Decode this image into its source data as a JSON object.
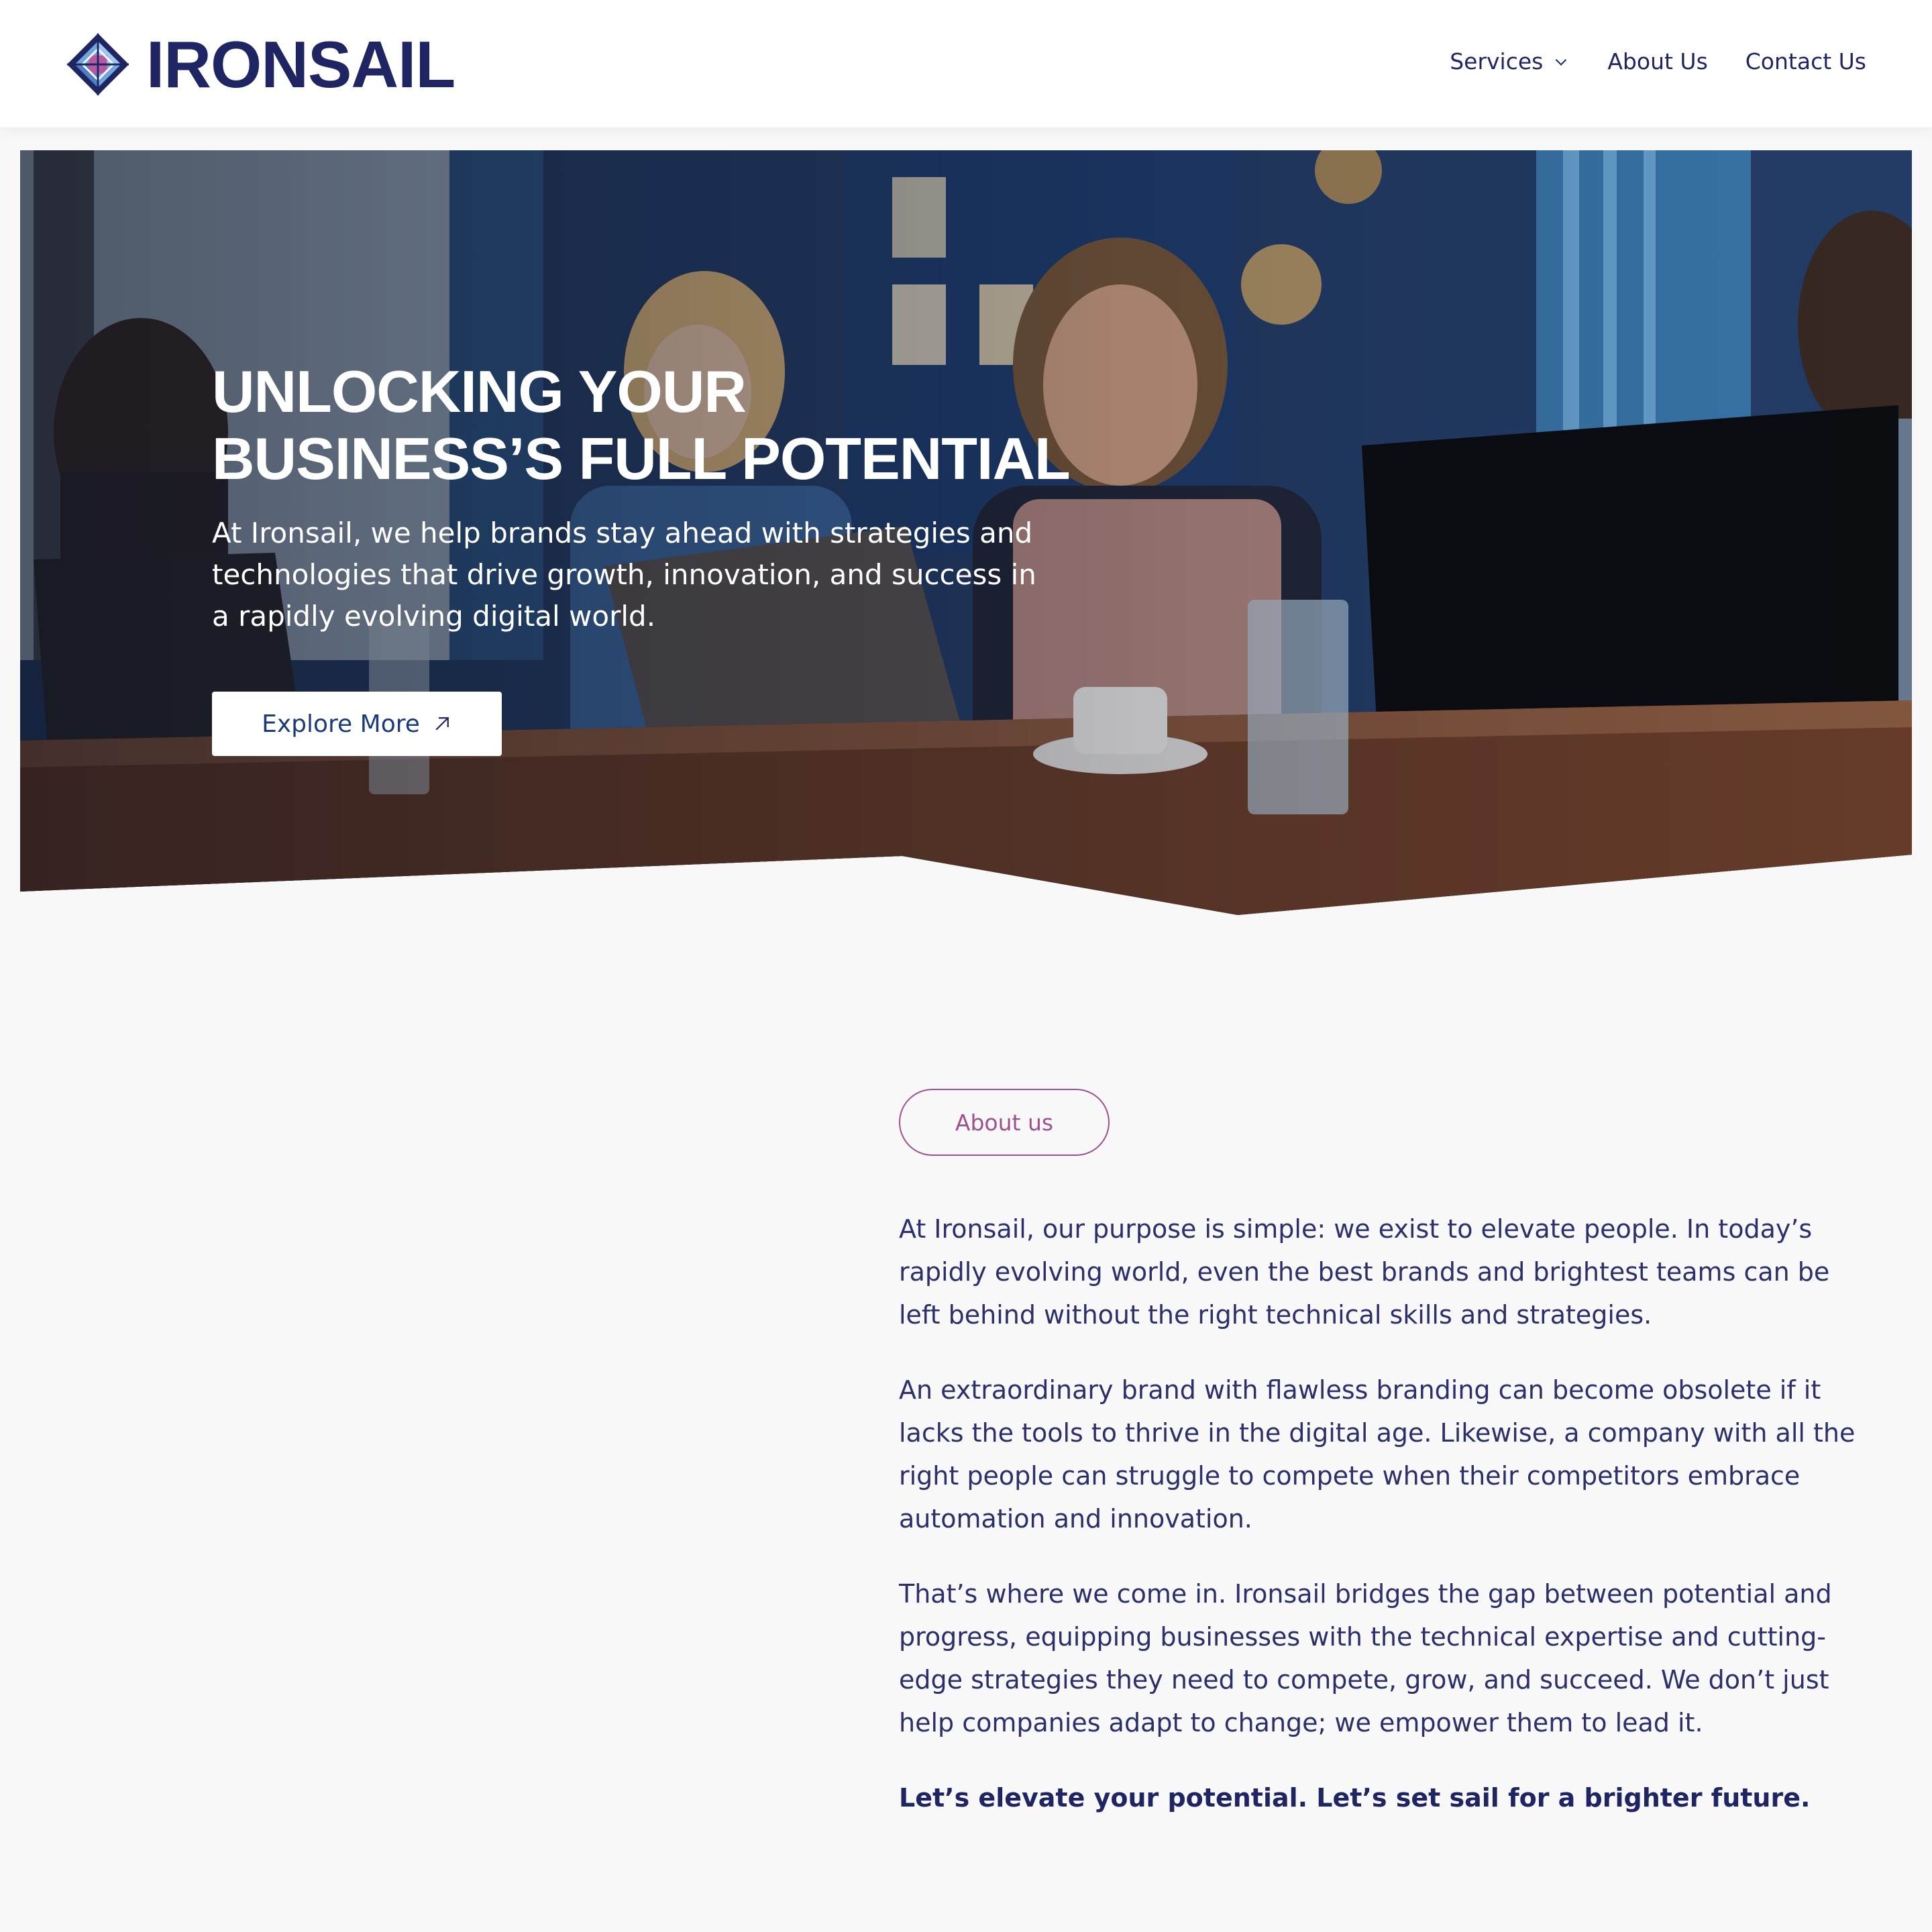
{
  "brand": {
    "name": "IRONSAIL",
    "colors": {
      "navy": "#1f2462",
      "accent": "#a0508f",
      "button_text": "#1d3b7c"
    }
  },
  "nav": {
    "items": [
      {
        "label": "Services",
        "has_dropdown": true,
        "icon": "chevron-down-icon"
      },
      {
        "label": "About Us"
      },
      {
        "label": "Contact Us"
      }
    ]
  },
  "hero": {
    "title_line1": "UNLOCKING YOUR",
    "title_line2": "BUSINESS’S FULL POTENTIAL",
    "subtitle": "At Ironsail, we help brands stay ahead with strategies and technologies that drive growth, innovation, and success in a rapidly evolving digital world.",
    "cta_label": "Explore More",
    "cta_icon": "arrow-up-right-icon"
  },
  "about": {
    "badge": "About us",
    "paragraphs": [
      "At Ironsail, our purpose is simple: we exist to elevate people. In today’s rapidly evolving world, even the best brands and brightest teams can be left behind without the right technical skills and strategies.",
      "An extraordinary brand with flawless branding can become obsolete if it lacks the tools to thrive in the digital age. Likewise, a company with all the right people can struggle to compete when their competitors embrace automation and innovation.",
      "That’s where we come in. Ironsail bridges the gap between potential and progress, equipping businesses with the technical expertise and cutting-edge strategies they need to compete, grow, and succeed. We don’t just help companies adapt to change; we empower them to lead it."
    ],
    "closing": "Let’s elevate your potential. Let’s set sail for a brighter future."
  }
}
